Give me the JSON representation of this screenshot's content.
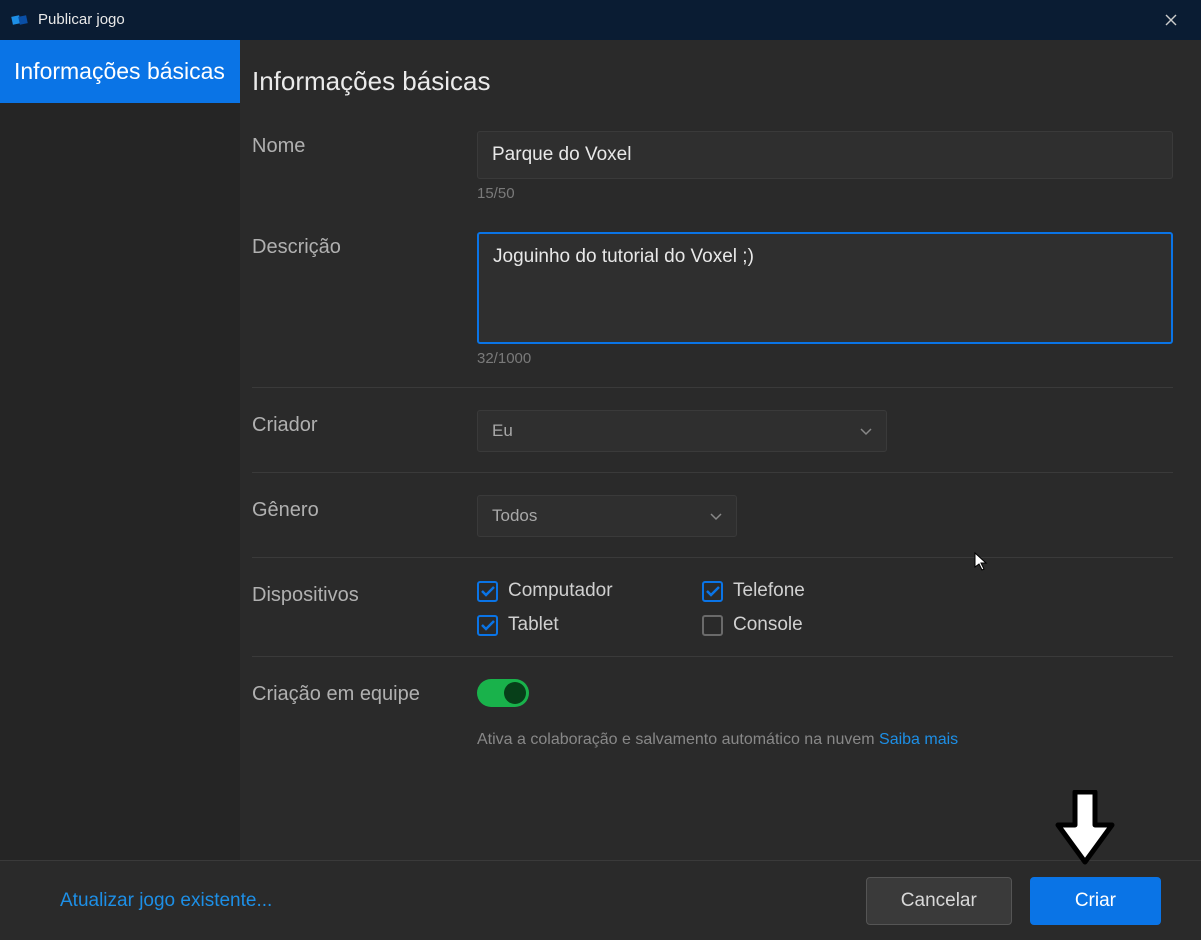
{
  "window": {
    "title": "Publicar jogo"
  },
  "sidebar": {
    "tabs": [
      {
        "label": "Informações básicas",
        "active": true
      }
    ]
  },
  "page": {
    "heading": "Informações básicas",
    "fields": {
      "name": {
        "label": "Nome",
        "value": "Parque do Voxel",
        "counter": "15/50"
      },
      "description": {
        "label": "Descrição",
        "value": "Joguinho do tutorial do Voxel ;)",
        "counter": "32/1000"
      },
      "creator": {
        "label": "Criador",
        "selected": "Eu"
      },
      "genre": {
        "label": "Gênero",
        "selected": "Todos"
      },
      "devices": {
        "label": "Dispositivos",
        "items": [
          {
            "label": "Computador",
            "checked": true
          },
          {
            "label": "Telefone",
            "checked": true
          },
          {
            "label": "Tablet",
            "checked": true
          },
          {
            "label": "Console",
            "checked": false
          }
        ]
      },
      "team_create": {
        "label": "Criação em equipe",
        "enabled": true,
        "description": "Ativa a colaboração e salvamento automático na nuvem",
        "link_text": "Saiba mais"
      }
    }
  },
  "footer": {
    "update_existing": "Atualizar jogo existente...",
    "cancel": "Cancelar",
    "create": "Criar"
  },
  "colors": {
    "accent": "#0a74e6",
    "success": "#19b24b",
    "bg": "#2a2a2a"
  }
}
